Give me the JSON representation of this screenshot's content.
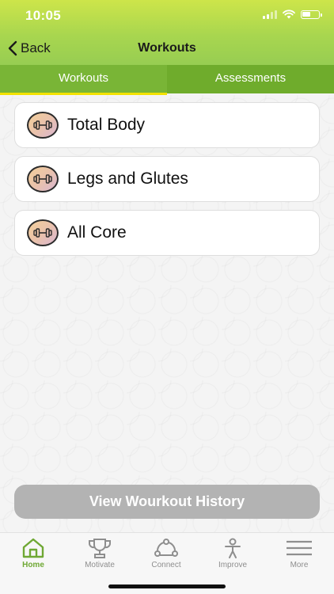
{
  "status_bar": {
    "time": "10:05"
  },
  "nav": {
    "back_label": "Back",
    "title": "Workouts"
  },
  "tabs": [
    {
      "label": "Workouts",
      "active": true
    },
    {
      "label": "Assessments",
      "active": false
    }
  ],
  "workouts": [
    {
      "label": "Total Body",
      "icon": "dumbbell-icon"
    },
    {
      "label": "Legs and Glutes",
      "icon": "dumbbell-icon"
    },
    {
      "label": "All Core",
      "icon": "dumbbell-icon"
    }
  ],
  "history_button": {
    "label": "View Wourkout History"
  },
  "tab_bar": [
    {
      "label": "Home",
      "icon": "home-icon",
      "active": true
    },
    {
      "label": "Motivate",
      "icon": "trophy-icon",
      "active": false
    },
    {
      "label": "Connect",
      "icon": "connect-icon",
      "active": false
    },
    {
      "label": "Improve",
      "icon": "person-icon",
      "active": false
    },
    {
      "label": "More",
      "icon": "menu-icon",
      "active": false
    }
  ],
  "colors": {
    "header_top": "#cde54a",
    "header_bottom": "#97cd52",
    "tab_bg": "#6fac2c",
    "tab_indicator": "#f3e200",
    "active_tab_bar": "#6fa834",
    "inactive_tab_bar": "#8e8e8e",
    "history_button": "#b3b3b3"
  }
}
